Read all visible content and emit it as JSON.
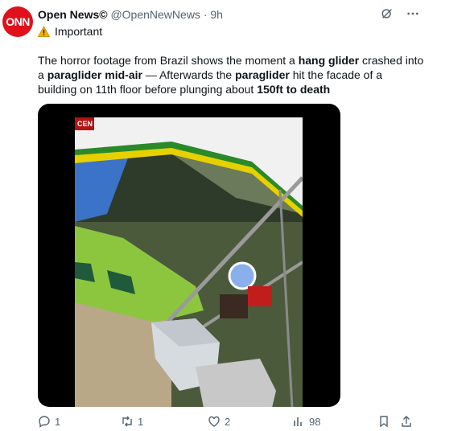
{
  "post": {
    "avatar_text": "ONN",
    "author_name": "Open News©",
    "handle": "@OpenNewNews",
    "separator": "·",
    "time": "9h",
    "tagline": "Important",
    "text": {
      "p1": "The horror footage from Brazil shows the moment a ",
      "b1": "hang glider",
      "p2": " crashed into a ",
      "b2": "paraglider mid-air",
      "p3": " — Afterwards the ",
      "b3": "paraglider",
      "p4": " hit the facade of a building on 11th floor before plunging about ",
      "b4": "150ft to death"
    },
    "media": {
      "watermark": "CEN"
    }
  },
  "actions": {
    "replies": "1",
    "reposts": "1",
    "likes": "2",
    "views": "98"
  },
  "colors": {
    "avatar_bg": "#e0111b",
    "muted": "#536471",
    "text": "#0f1419"
  }
}
